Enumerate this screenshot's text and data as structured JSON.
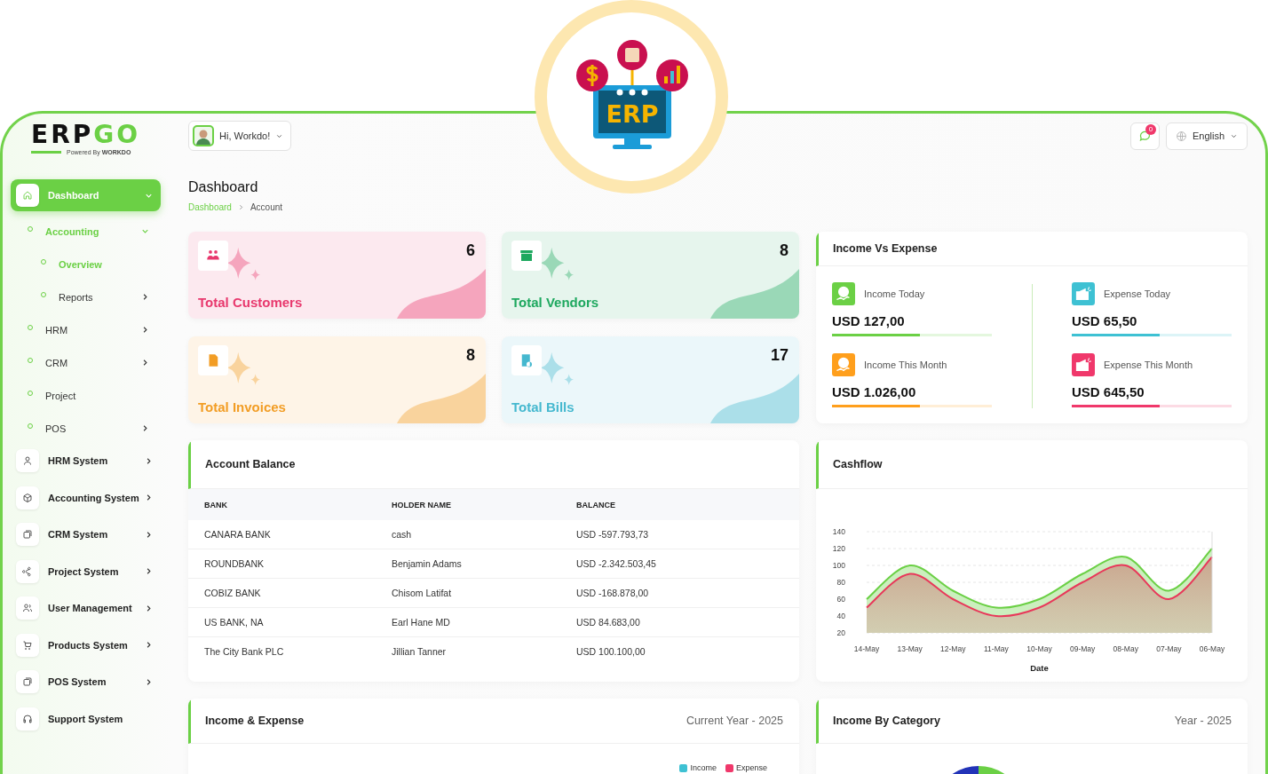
{
  "badge": {
    "label": "ERP"
  },
  "sidebar": {
    "logo": {
      "text": "ERP",
      "accent": "GO",
      "tagline": "Powered By **WORKDO**"
    },
    "items": [
      {
        "label": "Dashboard",
        "selected": true,
        "expanded": true,
        "expandable": true,
        "children": [
          {
            "label": "Accounting",
            "selected": true,
            "expanded": true,
            "expandable": true,
            "children": [
              {
                "label": "Overview",
                "selected": true,
                "expandable": false
              },
              {
                "label": "Reports",
                "selected": false,
                "expanded": false,
                "expandable": true
              }
            ]
          },
          {
            "label": "HRM",
            "selected": false,
            "expanded": false,
            "expandable": true
          },
          {
            "label": "CRM",
            "selected": false,
            "expanded": false,
            "expandable": true
          },
          {
            "label": "Project",
            "selected": false,
            "expanded": false,
            "expandable": false
          },
          {
            "label": "POS",
            "selected": false,
            "expanded": false,
            "expandable": true
          }
        ]
      },
      {
        "label": "HRM System",
        "selected": false,
        "expanded": false,
        "expandable": true
      },
      {
        "label": "Accounting System",
        "selected": false,
        "expanded": false,
        "expandable": true
      },
      {
        "label": "CRM System",
        "selected": false,
        "expanded": false,
        "expandable": true
      },
      {
        "label": "Project System",
        "selected": false,
        "expanded": false,
        "expandable": true
      },
      {
        "label": "User Management",
        "selected": false,
        "expanded": false,
        "expandable": true
      },
      {
        "label": "Products System",
        "selected": false,
        "expanded": false,
        "expandable": true
      },
      {
        "label": "POS System",
        "selected": false,
        "expanded": false,
        "expandable": true
      },
      {
        "label": "Support System",
        "selected": false,
        "expanded": false,
        "expandable": false
      }
    ]
  },
  "header": {
    "user": "Hi, Workdo!",
    "notifications": "0",
    "language": "English"
  },
  "page": {
    "title": "Dashboard",
    "breadcrumb": [
      "Dashboard",
      "Account"
    ]
  },
  "stats": [
    {
      "label": "Total Customers",
      "count": "6",
      "color": "#e8386d"
    },
    {
      "label": "Total Vendors",
      "count": "8",
      "color": "#1ea85f"
    },
    {
      "label": "Total Invoices",
      "count": "8",
      "color": "#f29d25"
    },
    {
      "label": "Total Bills",
      "count": "17",
      "color": "#45b8cf"
    }
  ],
  "income_vs_expense": {
    "title": "Income Vs Expense",
    "items": [
      {
        "label": "Income Today",
        "amount": "USD 127,00",
        "level": 0.55,
        "color": "#6bd045"
      },
      {
        "label": "Expense Today",
        "amount": "USD 65,50",
        "level": 0.55,
        "color": "#3ec1d3"
      },
      {
        "label": "Income This Month",
        "amount": "USD 1.026,00",
        "level": 0.55,
        "color": "#ff9f1c"
      },
      {
        "label": "Expense This Month",
        "amount": "USD 645,50",
        "level": 0.55,
        "color": "#f0386b"
      }
    ]
  },
  "account_balance": {
    "title": "Account Balance",
    "columns": [
      "BANK",
      "HOLDER NAME",
      "BALANCE"
    ],
    "rows": [
      [
        "CANARA BANK",
        "cash",
        "USD -597.793,73"
      ],
      [
        "ROUNDBANK",
        "Benjamin Adams",
        "USD -2.342.503,45"
      ],
      [
        "COBIZ BANK",
        "Chisom Latifat",
        "USD -168.878,00"
      ],
      [
        "US BANK, NA",
        "Earl Hane MD",
        "USD 84.683,00"
      ],
      [
        "The City Bank PLC",
        "Jillian Tanner",
        "USD 100.100,00"
      ]
    ]
  },
  "cashflow": {
    "title": "Cashflow",
    "chart_data": {
      "type": "area",
      "xlabel": "Date",
      "categories": [
        "14-May",
        "13-May",
        "12-May",
        "11-May",
        "10-May",
        "09-May",
        "08-May",
        "07-May",
        "06-May"
      ],
      "series": [
        {
          "color": "#6bd045",
          "values": [
            60,
            100,
            70,
            50,
            60,
            90,
            110,
            70,
            120
          ]
        },
        {
          "color": "#e8385a",
          "values": [
            50,
            90,
            60,
            40,
            50,
            80,
            100,
            60,
            110
          ]
        }
      ],
      "grid": true,
      "ylim": [
        20,
        140
      ],
      "yticks": [
        20,
        40,
        60,
        80,
        100,
        120,
        140
      ]
    }
  },
  "income_expense": {
    "title": "Income & Expense",
    "period": "Current Year - 2025",
    "legend": [
      {
        "label": "Income",
        "color": "#3ec1d3"
      },
      {
        "label": "Expense",
        "color": "#f0386b"
      }
    ]
  },
  "income_by_category": {
    "title": "Income By Category",
    "period": "Year - 2025"
  }
}
